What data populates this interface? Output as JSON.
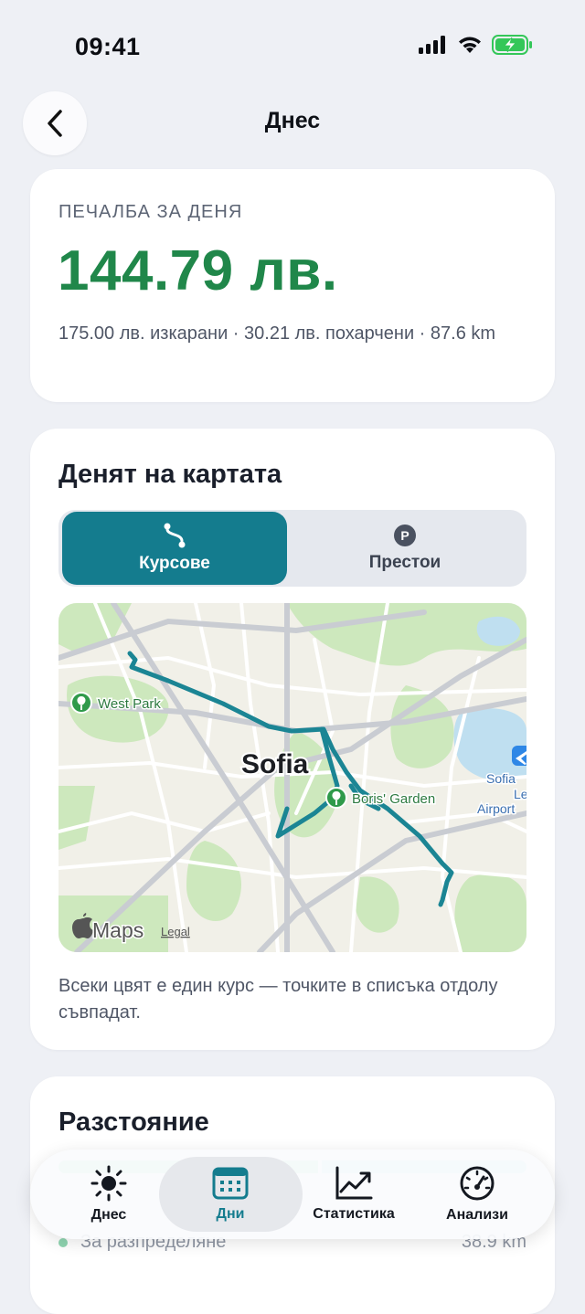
{
  "status_bar": {
    "time": "09:41"
  },
  "header": {
    "title": "Днес"
  },
  "profit_card": {
    "label": "ПЕЧАЛБА ЗА ДЕНЯ",
    "amount": "144.79 лв.",
    "summary": "175.00 лв. изкарани · 30.21 лв. похарчени · 87.6 km"
  },
  "map_card": {
    "heading": "Денят на картата",
    "segments": [
      {
        "label": "Курсове",
        "icon": "route-icon",
        "selected": true
      },
      {
        "label": "Престои",
        "icon": "parking-icon",
        "selected": false
      }
    ],
    "map": {
      "city_label": "Sofia",
      "poi": [
        "West Park",
        "Boris' Garden",
        "Sofia Airport"
      ],
      "poi_airport_lines": [
        "Sofia",
        "Airport"
      ],
      "attribution": "Maps",
      "legal": "Legal",
      "route_color": "#1b8594"
    },
    "caption": "Всеки цвят е един курс — точките в списъка отдолу съвпадат."
  },
  "distance_card": {
    "heading": "Разстояние",
    "legend": [
      {
        "label": "За разпределяне",
        "value": "38.9 km"
      }
    ]
  },
  "tab_bar": {
    "tabs": [
      {
        "label": "Днес",
        "icon": "sun-icon"
      },
      {
        "label": "Дни",
        "icon": "calendar-icon",
        "active": true
      },
      {
        "label": "Статистика",
        "icon": "chart-icon"
      },
      {
        "label": "Анализи",
        "icon": "gauge-icon"
      }
    ]
  },
  "colors": {
    "accent": "#147c8e",
    "profit": "#20874a",
    "background": "#eef0f5"
  }
}
